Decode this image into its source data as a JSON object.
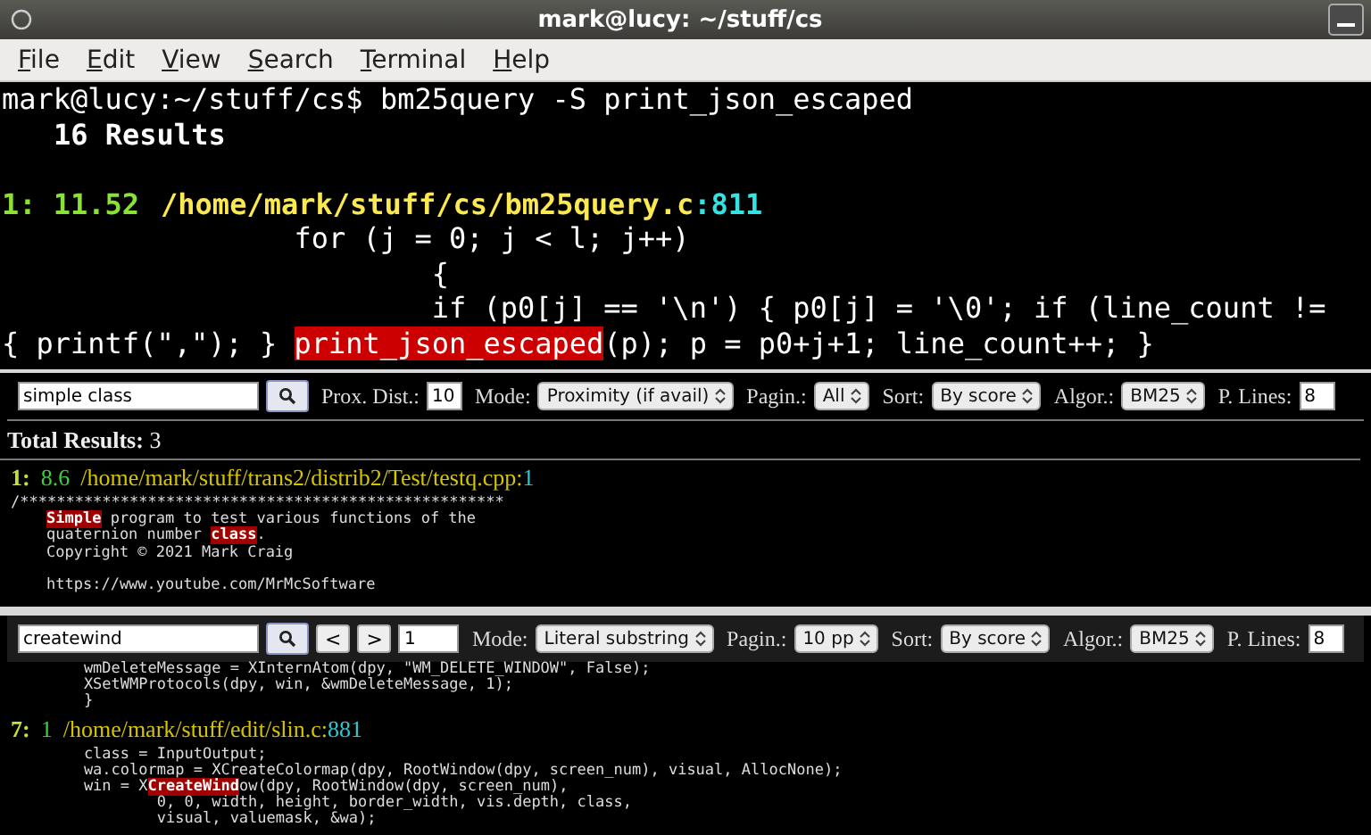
{
  "window": {
    "title": "mark@lucy: ~/stuff/cs"
  },
  "menu": [
    "File",
    "Edit",
    "View",
    "Search",
    "Terminal",
    "Help"
  ],
  "terminal": {
    "prompt": "mark@lucy:~/stuff/cs$",
    "command": "bm25query -S print_json_escaped",
    "results_header": "16 Results",
    "result": {
      "index": "1:",
      "score": "11.52",
      "path": "/home/mark/stuff/cs/bm25query.c",
      "line": ":811"
    },
    "code_lines": [
      {
        "segments": [
          {
            "text": "                 for (j = 0; j < l; j++)",
            "highlight": false
          }
        ]
      },
      {
        "segments": [
          {
            "text": "                         {",
            "highlight": false
          }
        ]
      },
      {
        "segments": [
          {
            "text": "                         if (p0[j] == '\\n') { p0[j] = '\\0'; if (line_count !=",
            "highlight": false
          }
        ]
      },
      {
        "segments": [
          {
            "text": "{ printf(\",\"); } ",
            "highlight": false
          },
          {
            "text": "print_json_escaped",
            "highlight": true
          },
          {
            "text": "(p); p = p0+j+1; line_count++; }",
            "highlight": false
          }
        ]
      }
    ]
  },
  "panels": [
    {
      "toolbar": [
        {
          "kind": "query",
          "value": "simple class"
        },
        {
          "kind": "search"
        },
        {
          "kind": "field",
          "label": "Prox. Dist.:",
          "value": "10"
        },
        {
          "kind": "select",
          "label": "Mode:",
          "value": "Proximity (if avail)"
        },
        {
          "kind": "select",
          "label": "Pagin.:",
          "value": "All"
        },
        {
          "kind": "select",
          "label": "Sort:",
          "value": "By score"
        },
        {
          "kind": "select",
          "label": "Algor.:",
          "value": "BM25"
        },
        {
          "kind": "field",
          "label": "P. Lines:",
          "value": "8"
        }
      ],
      "total_label": "Total Results:",
      "total": "3",
      "result": {
        "index": "1:",
        "score": "8.6",
        "path": "/home/mark/stuff/trans2/distrib2/Test/testq.cpp:",
        "line": "1"
      },
      "code_lines": [
        {
          "segments": [
            {
              "text": "/*****************************************************",
              "highlight": false
            }
          ]
        },
        {
          "segments": [
            {
              "text": "Simple",
              "highlight": true
            },
            {
              "text": " program to test various functions of the",
              "highlight": false
            }
          ]
        },
        {
          "segments": [
            {
              "text": "quaternion number ",
              "highlight": false
            },
            {
              "text": "class",
              "highlight": true
            },
            {
              "text": ".",
              "highlight": false
            }
          ]
        },
        {
          "segments": [
            {
              "text": "Copyright © 2021 Mark Craig",
              "highlight": false
            }
          ]
        },
        {
          "blank": true
        },
        {
          "segments": [
            {
              "text": "https://www.youtube.com/MrMcSoftware",
              "highlight": false
            }
          ]
        }
      ]
    },
    {
      "toolbar": [
        {
          "kind": "query",
          "value": "createwind"
        },
        {
          "kind": "search"
        },
        {
          "kind": "nav",
          "text": "<"
        },
        {
          "kind": "nav",
          "text": ">"
        },
        {
          "kind": "page",
          "value": "1"
        },
        {
          "kind": "select",
          "label": "Mode:",
          "value": "Literal substring"
        },
        {
          "kind": "select",
          "label": "Pagin.:",
          "value": "10 pp"
        },
        {
          "kind": "select",
          "label": "Sort:",
          "value": "By score"
        },
        {
          "kind": "select",
          "label": "Algor.:",
          "value": "BM25"
        },
        {
          "kind": "field",
          "label": "P. Lines:",
          "value": "8"
        }
      ],
      "before_lines": [
        {
          "segments": [
            {
              "text": "        wmDeleteMessage = XInternAtom(dpy, \"WM_DELETE_WINDOW\", False);",
              "highlight": false
            }
          ]
        },
        {
          "segments": [
            {
              "text": "        XSetWMProtocols(dpy, win, &wmDeleteMessage, 1);",
              "highlight": false
            }
          ]
        },
        {
          "segments": [
            {
              "text": "        }",
              "highlight": false
            }
          ]
        }
      ],
      "result": {
        "index": "7:",
        "score": "1",
        "path": "/home/mark/stuff/edit/slin.c:",
        "line": "881"
      },
      "code_lines": [
        {
          "segments": [
            {
              "text": "        class = InputOutput;",
              "highlight": false
            }
          ]
        },
        {
          "segments": [
            {
              "text": "        wa.colormap = XCreateColormap(dpy, RootWindow(dpy, screen_num), visual, AllocNone);",
              "highlight": false
            }
          ]
        },
        {
          "segments": [
            {
              "text": "        win = X",
              "highlight": false
            },
            {
              "text": "CreateWind",
              "highlight": true
            },
            {
              "text": "ow(dpy, RootWindow(dpy, screen_num),",
              "highlight": false
            }
          ]
        },
        {
          "segments": [
            {
              "text": "                0, 0, width, height, border_width, vis.depth, class,",
              "highlight": false
            }
          ]
        },
        {
          "segments": [
            {
              "text": "                visual, valuemask, &wa);",
              "highlight": false
            }
          ]
        }
      ]
    }
  ]
}
